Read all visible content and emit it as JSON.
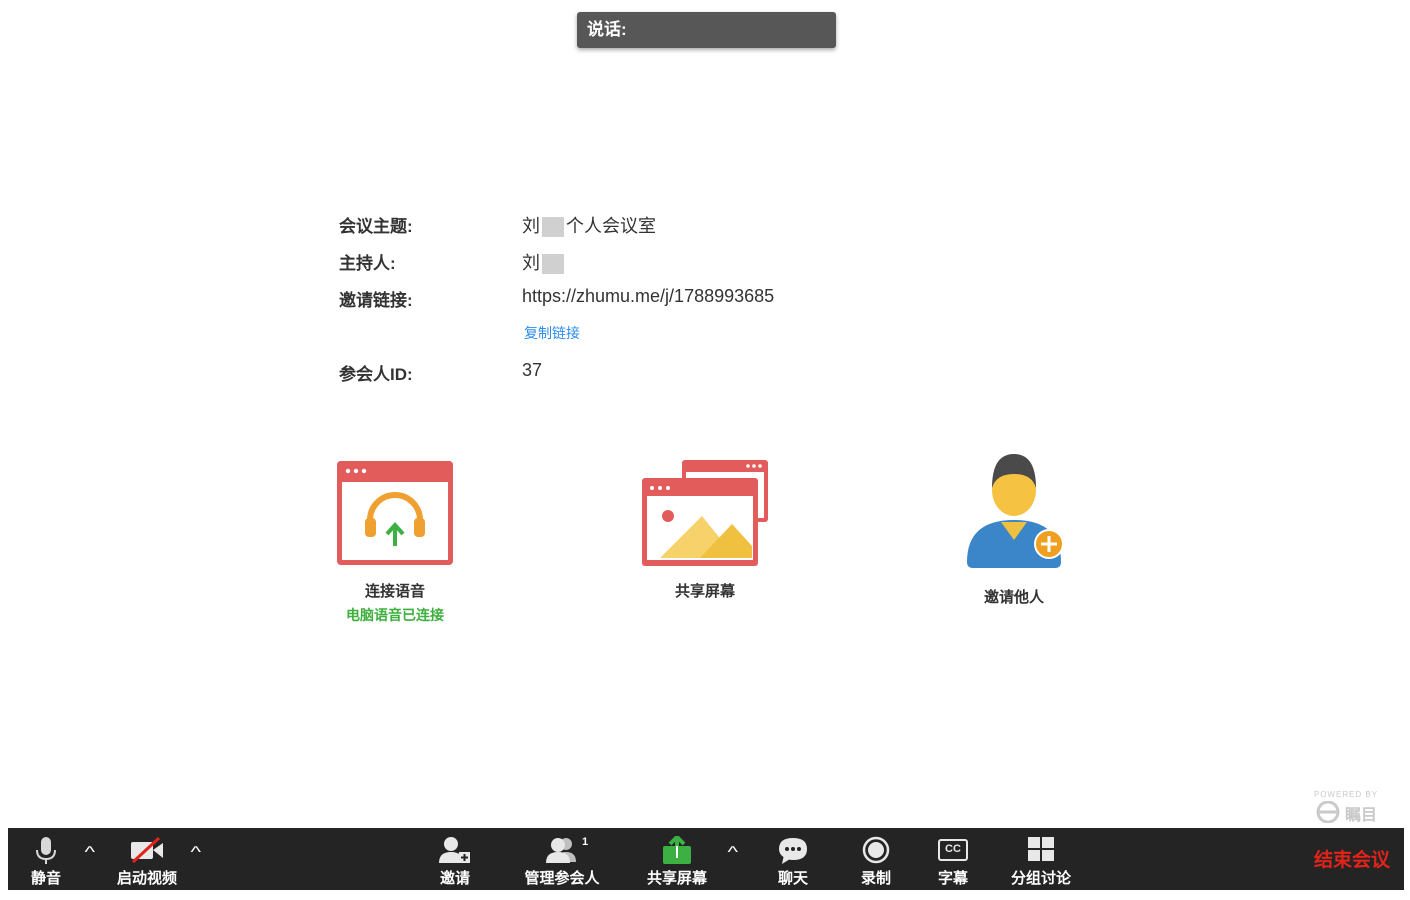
{
  "banner": {
    "speaking_label": "说话:"
  },
  "meeting": {
    "topic_label": "会议主题:",
    "topic_value_prefix": "刘",
    "topic_value_suffix": "个人会议室",
    "host_label": "主持人:",
    "host_value": "刘",
    "invite_link_label": "邀请链接:",
    "invite_link_value": "https://zhumu.me/j/1788993685",
    "copy_link_label": "复制链接",
    "participant_id_label": "参会人ID:",
    "participant_id_value": "37"
  },
  "actions": {
    "audio": {
      "label": "连接语音",
      "status": "电脑语音已连接"
    },
    "share": {
      "label": "共享屏幕"
    },
    "invite": {
      "label": "邀请他人"
    }
  },
  "watermark": {
    "powered_by": "POWERED BY",
    "brand": "瞩目"
  },
  "toolbar": {
    "mute": "静音",
    "video": "启动视频",
    "invite": "邀请",
    "manage_participants": "管理参会人",
    "participant_count": "1",
    "share_screen": "共享屏幕",
    "chat": "聊天",
    "record": "录制",
    "captions": "字幕",
    "cc_text": "CC",
    "breakout": "分组讨论",
    "end_meeting": "结束会议"
  },
  "colors": {
    "toolbar_bg": "#242424",
    "end_meeting": "#e2231a",
    "link_blue": "#2d8cf0",
    "connected_green": "#3fb03f",
    "window_red": "#e25c5c",
    "share_green": "#3cb043"
  }
}
